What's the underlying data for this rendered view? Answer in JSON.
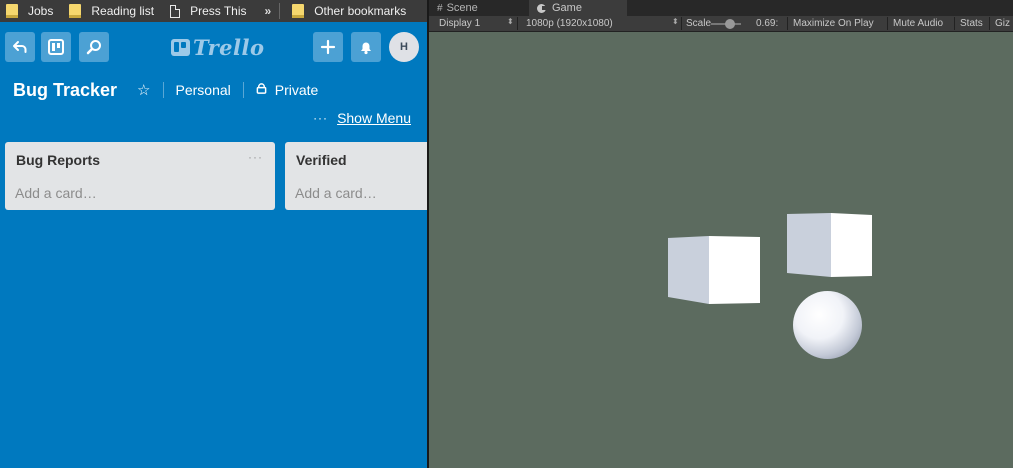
{
  "bookmarks": {
    "items": [
      {
        "label": "Jobs",
        "icon": "folder-icon"
      },
      {
        "label": "Reading list",
        "icon": "folder-icon"
      },
      {
        "label": "Press This",
        "icon": "page-icon"
      }
    ],
    "overflow": "»",
    "other": {
      "label": "Other bookmarks",
      "icon": "folder-icon"
    }
  },
  "trello": {
    "header": {
      "back_icon": "↶",
      "search_icon": "search-icon",
      "logo_text": "Trello",
      "add_icon": "+",
      "avatar_initial": "H"
    },
    "board": {
      "title": "Bug Tracker",
      "star_icon": "☆",
      "team": "Personal",
      "lock_icon": "lock-icon",
      "visibility": "Private"
    },
    "show_menu": {
      "dots": "···",
      "label": "Show Menu"
    },
    "lists": [
      {
        "title": "Bug Reports",
        "menu": "···",
        "add_card": "Add a card…"
      },
      {
        "title": "Verified",
        "menu": "",
        "add_card": "Add a card…"
      }
    ]
  },
  "unity": {
    "tabs": {
      "scene": "Scene",
      "game": "Game"
    },
    "toolbar": {
      "display": "Display 1",
      "resolution": "1080p (1920x1080)",
      "scale_label": "Scale",
      "scale_value": "0.69:",
      "maximize": "Maximize On Play",
      "mute": "Mute Audio",
      "stats": "Stats",
      "gizmos": "Giz"
    },
    "colors": {
      "background": "#5c6b5f",
      "object_face": "#ffffff",
      "object_side": "#c9d0dc"
    }
  }
}
